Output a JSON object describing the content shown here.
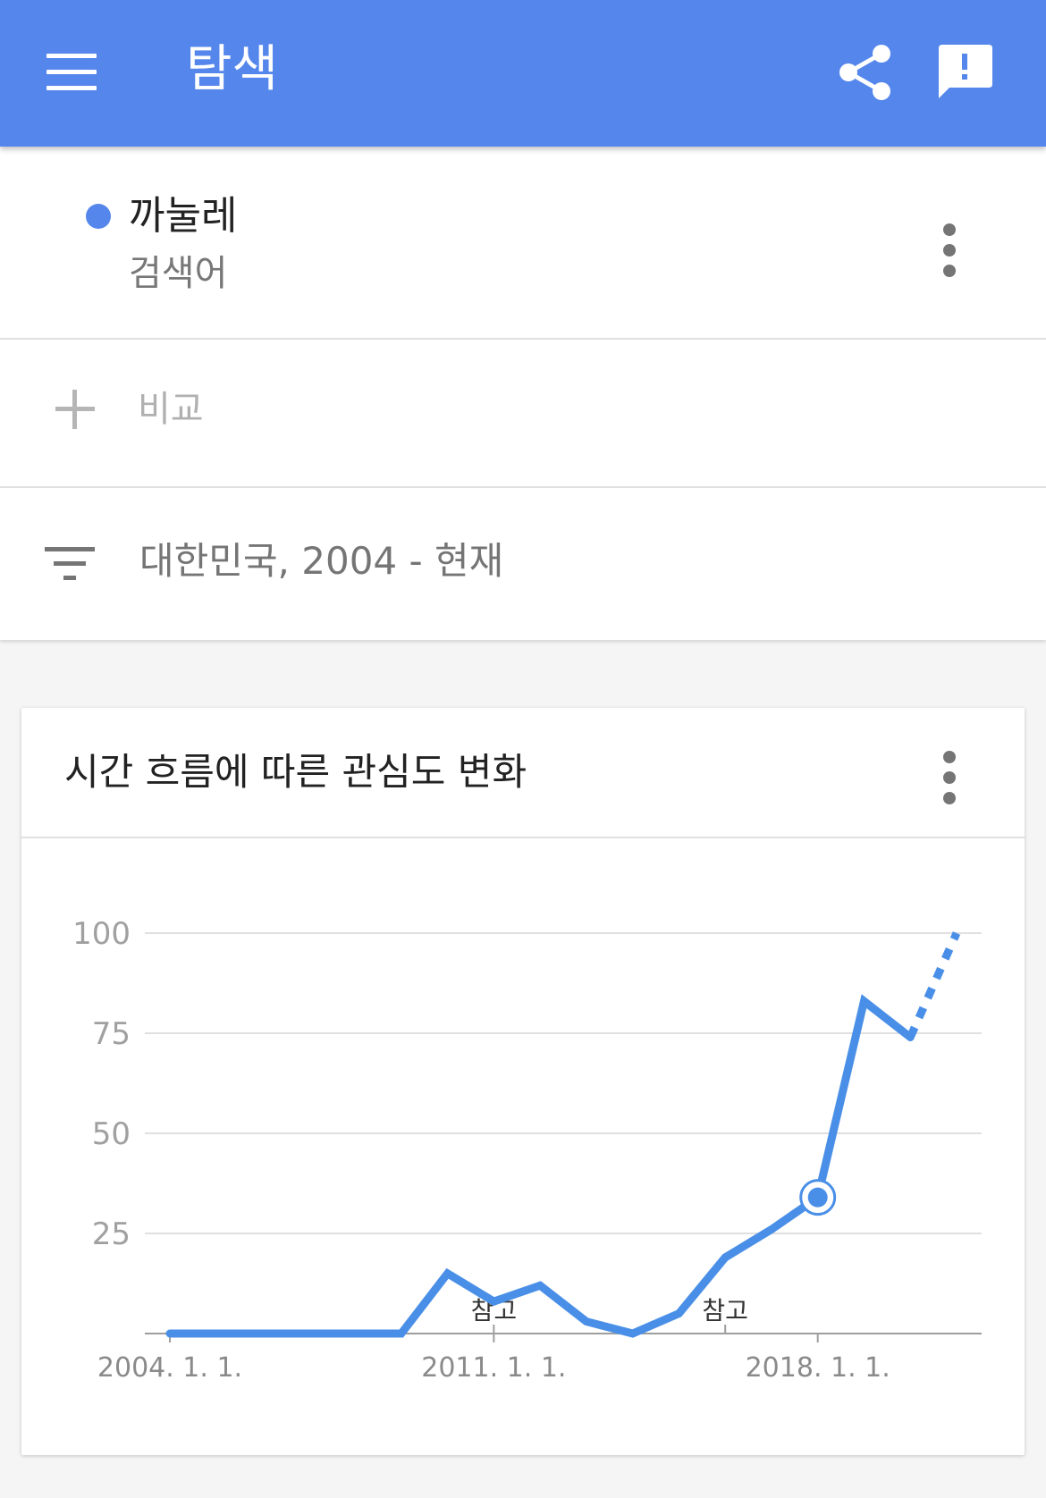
{
  "appbar": {
    "title": "탐색",
    "menu_icon": "hamburger-menu-icon",
    "share_icon": "share-icon",
    "feedback_icon": "feedback-icon",
    "bg_color": "#5486ec"
  },
  "search_term": {
    "name": "까눌레",
    "type": "검색어",
    "color": "#5486ec"
  },
  "compare": {
    "label": "비교"
  },
  "filter": {
    "label": "대한민국, 2004 - 현재"
  },
  "chart_card": {
    "title": "시간 흐름에 따른 관심도 변화"
  },
  "chart_data": {
    "type": "line",
    "title": "시간 흐름에 따른 관심도 변화",
    "xlabel": "",
    "ylabel": "",
    "ylim": [
      0,
      100
    ],
    "y_ticks": [
      25,
      50,
      75,
      100
    ],
    "x_ticks": [
      {
        "label": "2004. 1. 1.",
        "year": 2004
      },
      {
        "label": "2011. 1. 1.",
        "year": 2011
      },
      {
        "label": "2018. 1. 1.",
        "year": 2018
      }
    ],
    "annotations": [
      {
        "label": "참고",
        "year": 2011
      },
      {
        "label": "참고",
        "year": 2016
      }
    ],
    "highlight_point": {
      "year": 2018,
      "value": 34
    },
    "grid": true,
    "legend": "none",
    "series": [
      {
        "color": "#4a8fe7",
        "solid": [
          {
            "year": 2004,
            "value": 0
          },
          {
            "year": 2009,
            "value": 0
          },
          {
            "year": 2010,
            "value": 15
          },
          {
            "year": 2011,
            "value": 8
          },
          {
            "year": 2012,
            "value": 12
          },
          {
            "year": 2013,
            "value": 3
          },
          {
            "year": 2014,
            "value": 0
          },
          {
            "year": 2015,
            "value": 5
          },
          {
            "year": 2016,
            "value": 19
          },
          {
            "year": 2017,
            "value": 26
          },
          {
            "year": 2018,
            "value": 34
          },
          {
            "year": 2019,
            "value": 83
          },
          {
            "year": 2020,
            "value": 74
          }
        ],
        "projected": [
          {
            "year": 2020,
            "value": 74
          },
          {
            "year": 2021,
            "value": 100
          }
        ]
      }
    ]
  }
}
